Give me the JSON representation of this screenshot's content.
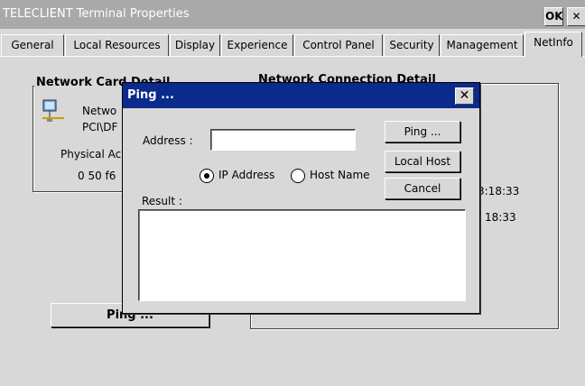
{
  "window": {
    "title": "TELECLIENT Terminal Properties",
    "ok_label": "OK",
    "close_label": "✕"
  },
  "tabs": [
    {
      "label": "General"
    },
    {
      "label": "Local Resources"
    },
    {
      "label": "Display"
    },
    {
      "label": "Experience"
    },
    {
      "label": "Control Panel"
    },
    {
      "label": "Security"
    },
    {
      "label": "Management"
    },
    {
      "label": "NetInfo",
      "active": true
    }
  ],
  "netinfo": {
    "network_card_title": "Network Card Detail",
    "card_name_partial": "Netwo",
    "card_id_partial": "PCI\\DF",
    "physical_label_partial": "Physical Ac",
    "mac_partial": "0 50 f6",
    "network_connection_title": "Network Connection Detail",
    "time1_partial": "3:18:33",
    "time2_partial": "18:33",
    "ping_button_partial": "Ping ..."
  },
  "ping_dialog": {
    "title": "Ping ...",
    "close_label": "✕",
    "address_label": "Address :",
    "address_value": "",
    "ip_address_label": "IP Address",
    "host_name_label": "Host Name",
    "selected_mode": "IP Address",
    "result_label": "Result :",
    "result_value": "",
    "ping_button": "Ping ...",
    "local_host_button": "Local Host",
    "cancel_button": "Cancel"
  },
  "icons": {
    "network_card": "network-card-icon"
  }
}
